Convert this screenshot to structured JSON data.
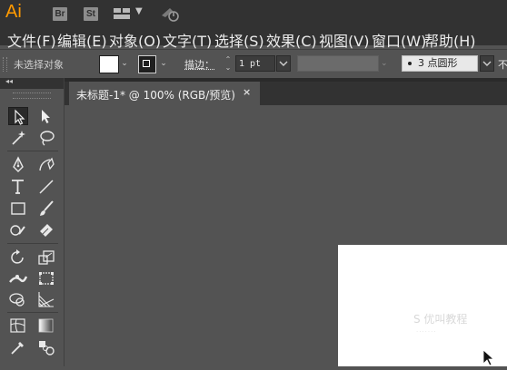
{
  "app": {
    "logo": "Ai",
    "bridge_button": "Br",
    "stock_button": "St",
    "layout_icon": "workspace-layout-icon",
    "sync_icon": "sync-settings-icon"
  },
  "menu": {
    "items": [
      {
        "label": "文件(F)"
      },
      {
        "label": "编辑(E)"
      },
      {
        "label": "对象(O)"
      },
      {
        "label": "文字(T)"
      },
      {
        "label": "选择(S)"
      },
      {
        "label": "效果(C)"
      },
      {
        "label": "视图(V)"
      },
      {
        "label": "窗口(W)"
      },
      {
        "label": "帮助(H)"
      }
    ]
  },
  "control_bar": {
    "selection_status": "未选择对象",
    "fill_color": "#ffffff",
    "stroke_label": "描边：",
    "stroke_weight": "1 pt",
    "brush_definition": "3 点圆形",
    "opacity_label": "不"
  },
  "document": {
    "tab_label": "未标题-1* @ 100% (RGB/预览)",
    "close_glyph": "×",
    "artboard_color": "#ffffff"
  },
  "watermark": {
    "text": "S 优叫教程",
    "sub": "·······"
  },
  "colors": {
    "app_bar": "#323232",
    "workspace": "#535353",
    "ai_orange": "#ff9a00"
  },
  "tools": [
    "selection-tool-icon",
    "direct-selection-tool-icon",
    "magic-wand-tool-icon",
    "lasso-tool-icon",
    "pen-tool-icon",
    "curvature-tool-icon",
    "type-tool-icon",
    "line-segment-tool-icon",
    "rectangle-tool-icon",
    "paintbrush-tool-icon",
    "shaper-tool-icon",
    "eraser-tool-icon",
    "rotate-tool-icon",
    "scale-tool-icon",
    "width-tool-icon",
    "free-transform-tool-icon",
    "shape-builder-tool-icon",
    "perspective-grid-tool-icon",
    "mesh-tool-icon",
    "gradient-tool-icon",
    "eyedropper-tool-icon",
    "blend-tool-icon"
  ]
}
